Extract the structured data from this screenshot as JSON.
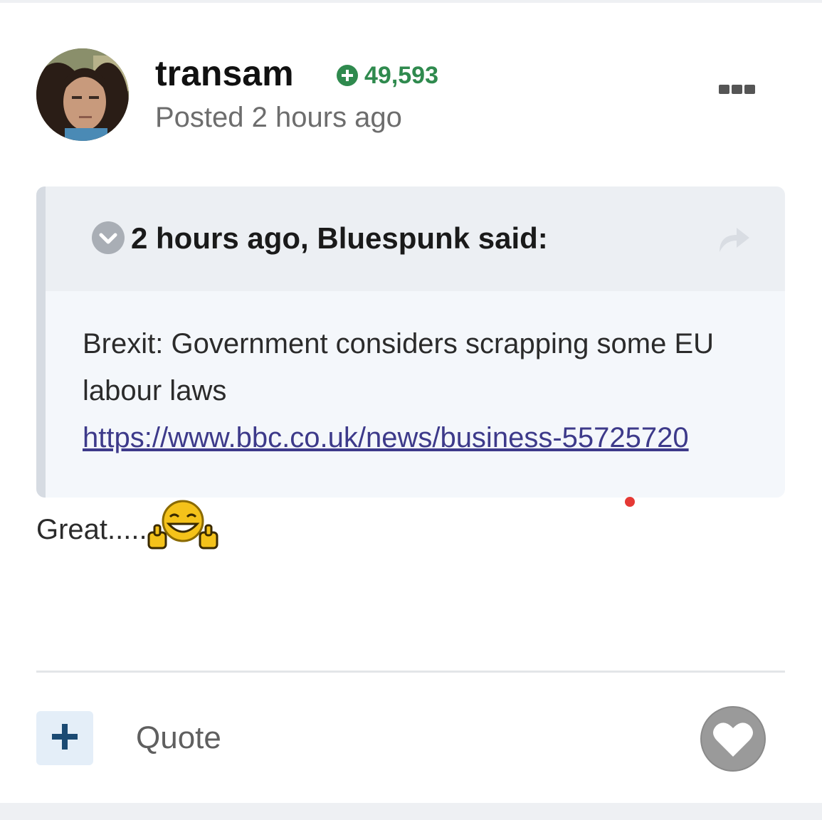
{
  "post": {
    "author": {
      "username": "transam",
      "reputation": "49,593",
      "reputation_icon": "plus-circle-icon"
    },
    "timestamp": "Posted 2 hours ago",
    "menu_icon": "ellipsis-icon",
    "quote": {
      "citation": "2 hours ago, Bluespunk said:",
      "toggle_icon": "chevron-down-circle-icon",
      "share_icon": "share-arrow-icon",
      "text": "Brexit: Government considers scrapping some EU labour laws",
      "link": "https://www.bbc.co.uk/news/business-55725720"
    },
    "reply_text": "Great.....",
    "emoji": "laughing-thumbs-up-emoji"
  },
  "actions": {
    "plus_icon": "plus-icon",
    "quote_label": "Quote",
    "like_icon": "heart-icon"
  },
  "colors": {
    "reputation": "#2f8a4e",
    "link": "#3d3a8a",
    "quote_background": "#f4f7fb",
    "quote_header": "#eceff3",
    "plus_button_bg": "#e4eef8",
    "plus_icon": "#1b4a73",
    "heart_button": "#9a9a9a"
  }
}
